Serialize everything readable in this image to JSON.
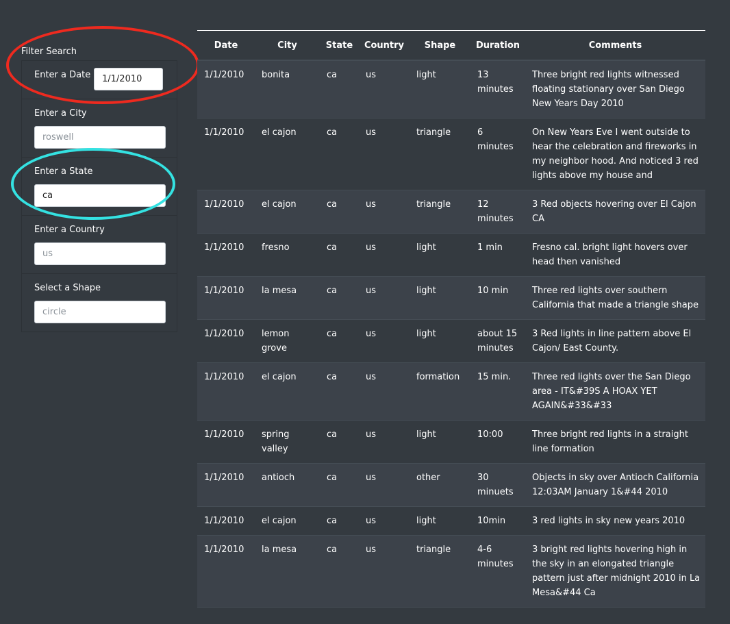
{
  "filters": {
    "title": "Filter Search",
    "date": {
      "label": "Enter a Date",
      "value": "1/1/2010",
      "placeholder": ""
    },
    "city": {
      "label": "Enter a City",
      "value": "",
      "placeholder": "roswell"
    },
    "state": {
      "label": "Enter a State",
      "value": "ca",
      "placeholder": ""
    },
    "country": {
      "label": "Enter a Country",
      "value": "",
      "placeholder": "us"
    },
    "shape": {
      "label": "Select a Shape",
      "value": "",
      "placeholder": "circle"
    }
  },
  "annotations": {
    "red_circle_color": "#ee2a1f",
    "cyan_circle_color": "#34e2e2"
  },
  "table": {
    "headers": [
      "Date",
      "City",
      "State",
      "Country",
      "Shape",
      "Duration",
      "Comments"
    ],
    "rows": [
      [
        "1/1/2010",
        "bonita",
        "ca",
        "us",
        "light",
        "13 minutes",
        "Three bright red lights witnessed floating stationary over San Diego New Years Day 2010"
      ],
      [
        "1/1/2010",
        "el cajon",
        "ca",
        "us",
        "triangle",
        "6 minutes",
        "On New Years Eve I went outside to hear the celebration and fireworks in my neighbor hood. And noticed 3 red lights above my house and"
      ],
      [
        "1/1/2010",
        "el cajon",
        "ca",
        "us",
        "triangle",
        "12 minutes",
        "3 Red objects hovering over El Cajon CA"
      ],
      [
        "1/1/2010",
        "fresno",
        "ca",
        "us",
        "light",
        "1 min",
        "Fresno cal. bright light hovers over head then vanished"
      ],
      [
        "1/1/2010",
        "la mesa",
        "ca",
        "us",
        "light",
        "10 min",
        "Three red lights over southern California that made a triangle shape"
      ],
      [
        "1/1/2010",
        "lemon grove",
        "ca",
        "us",
        "light",
        "about 15 minutes",
        "3 Red lights in line pattern above El Cajon/ East County."
      ],
      [
        "1/1/2010",
        "el cajon",
        "ca",
        "us",
        "formation",
        "15 min.",
        "Three red lights over the San Diego area - IT&#39S A HOAX YET AGAIN&#33&#33"
      ],
      [
        "1/1/2010",
        "spring valley",
        "ca",
        "us",
        "light",
        "10:00",
        "Three bright red lights in a straight line formation"
      ],
      [
        "1/1/2010",
        "antioch",
        "ca",
        "us",
        "other",
        "30 minuets",
        "Objects in sky over Antioch California 12:03AM January 1&#44 2010"
      ],
      [
        "1/1/2010",
        "el cajon",
        "ca",
        "us",
        "light",
        "10min",
        "3 red lights in sky new years 2010"
      ],
      [
        "1/1/2010",
        "la mesa",
        "ca",
        "us",
        "triangle",
        "4-6 minutes",
        "3 bright red lights hovering high in the sky in an elongated triangle pattern just after midnight 2010 in La Mesa&#44 Ca"
      ]
    ]
  }
}
